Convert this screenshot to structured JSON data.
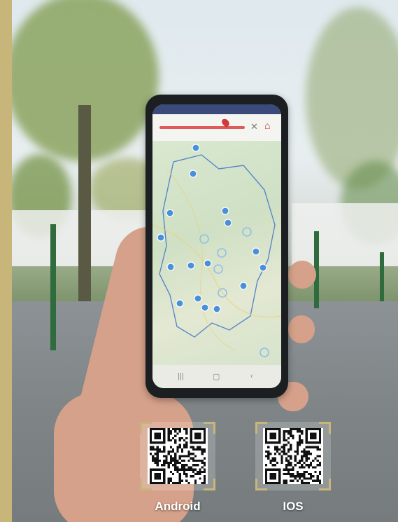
{
  "qr_codes": [
    {
      "label": "Android",
      "icon": "qr-code-icon"
    },
    {
      "label": "IOS",
      "icon": "qr-code-icon"
    }
  ],
  "colors": {
    "accent_gold": "#c8b57a",
    "label_text": "#ffffff",
    "map_pin": "#4a90d9"
  }
}
